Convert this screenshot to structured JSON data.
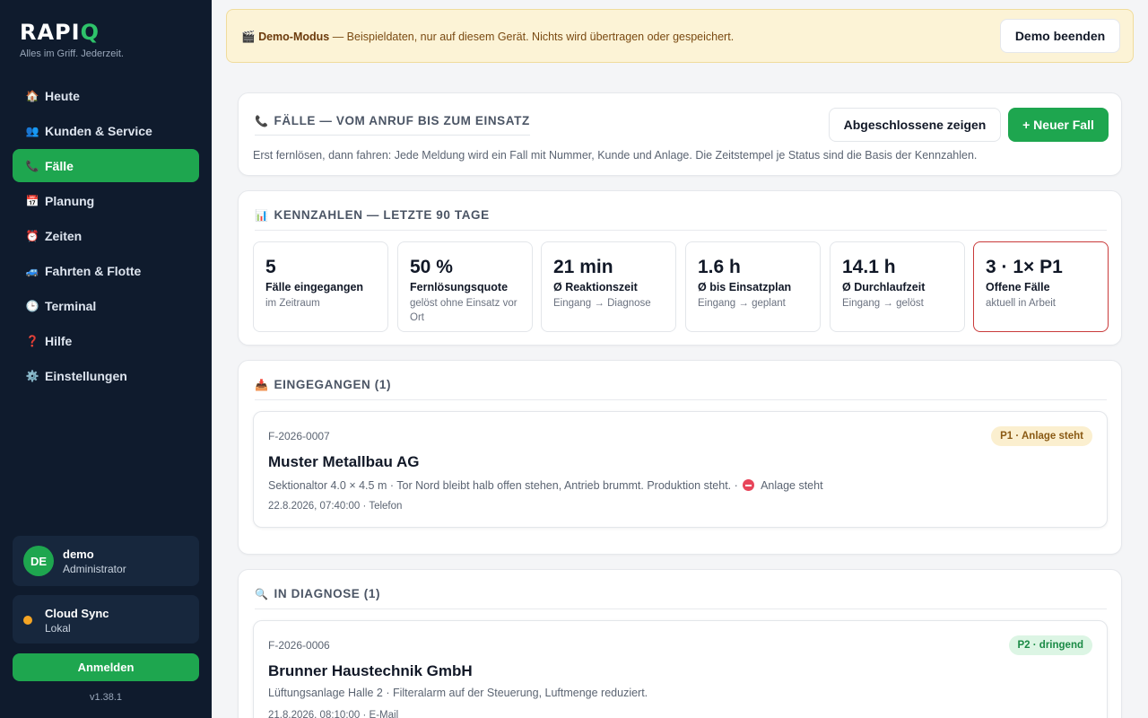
{
  "app": {
    "logo_main": "RAPI",
    "logo_accent": "Q",
    "tagline": "Alles im Griff. Jederzeit.",
    "version": "v1.38.1"
  },
  "nav": {
    "items": [
      {
        "label": "Heute",
        "icon": "house-icon",
        "glyph": "🏠"
      },
      {
        "label": "Kunden & Service",
        "icon": "people-icon",
        "glyph": "👥"
      },
      {
        "label": "Fälle",
        "icon": "phone-icon",
        "glyph": "📞"
      },
      {
        "label": "Planung",
        "icon": "calendar-icon",
        "glyph": "📅"
      },
      {
        "label": "Zeiten",
        "icon": "alarm-clock-icon",
        "glyph": "⏰"
      },
      {
        "label": "Fahrten & Flotte",
        "icon": "car-icon",
        "glyph": "🚙"
      },
      {
        "label": "Terminal",
        "icon": "clock-icon",
        "glyph": "🕒"
      },
      {
        "label": "Hilfe",
        "icon": "question-icon",
        "glyph": "❓"
      },
      {
        "label": "Einstellungen",
        "icon": "gear-icon",
        "glyph": "⚙️"
      }
    ],
    "active_index": 2
  },
  "user": {
    "initials": "DE",
    "name": "demo",
    "role": "Administrator"
  },
  "sync": {
    "title": "Cloud Sync",
    "status": "Lokal",
    "status_color": "#f5a524"
  },
  "login_label": "Anmelden",
  "banner": {
    "icon": "clapper-icon",
    "glyph": "🎬",
    "title": "Demo-Modus",
    "text": " — Beispieldaten, nur auf diesem Gerät. Nichts wird übertragen oder gespeichert.",
    "button": "Demo beenden"
  },
  "faelle": {
    "icon": "phone-icon",
    "glyph": "📞",
    "title": "FÄLLE — VOM ANRUF BIS ZUM EINSATZ",
    "description": "Erst fernlösen, dann fahren: Jede Meldung wird ein Fall mit Nummer, Kunde und Anlage. Die Zeitstempel je Status sind die Basis der Kennzahlen.",
    "show_closed_label": "Abgeschlossene zeigen",
    "new_case_label": "+ Neuer Fall"
  },
  "kpis": {
    "icon": "bar-chart-icon",
    "glyph": "📊",
    "title": "KENNZAHLEN — LETZTE 90 TAGE",
    "items": [
      {
        "value": "5",
        "label": "Fälle eingegangen",
        "sub": "im Zeitraum",
        "alert": false
      },
      {
        "value": "50 %",
        "label": "Fernlösungsquote",
        "sub": "gelöst ohne Einsatz vor Ort",
        "alert": false
      },
      {
        "value": "21 min",
        "label": "Ø Reaktionszeit",
        "sub": "Eingang → Diagnose",
        "alert": false
      },
      {
        "value": "1.6 h",
        "label": "Ø bis Einsatzplan",
        "sub": "Eingang → geplant",
        "alert": false
      },
      {
        "value": "14.1 h",
        "label": "Ø Durchlaufzeit",
        "sub": "Eingang → gelöst",
        "alert": false
      },
      {
        "value": "3 · 1× P1",
        "label": "Offene Fälle",
        "sub": "aktuell in Arbeit",
        "alert": true
      }
    ]
  },
  "sections": [
    {
      "icon": "inbox-icon",
      "glyph": "📥",
      "title": "EINGEGANGEN (1)",
      "cases": [
        {
          "number": "F-2026-0007",
          "customer": "Muster Metallbau AG",
          "description": "Sektionaltor 4.0 × 4.5 m · Tor Nord bleibt halb offen stehen, Antrieb brummt. Produktion steht. ·",
          "status_text": "Anlage steht",
          "meta": "22.8.2026, 07:40:00 · Telefon",
          "badge": "P1 · Anlage steht",
          "priority": "p1"
        }
      ]
    },
    {
      "icon": "magnifier-icon",
      "glyph": "🔍",
      "title": "IN DIAGNOSE (1)",
      "cases": [
        {
          "number": "F-2026-0006",
          "customer": "Brunner Haustechnik GmbH",
          "description": "Lüftungsanlage Halle 2 · Filteralarm auf der Steuerung, Luftmenge reduziert.",
          "status_text": "",
          "meta": "21.8.2026, 08:10:00 · E-Mail",
          "badge": "P2 · dringend",
          "priority": "p2"
        }
      ]
    }
  ]
}
